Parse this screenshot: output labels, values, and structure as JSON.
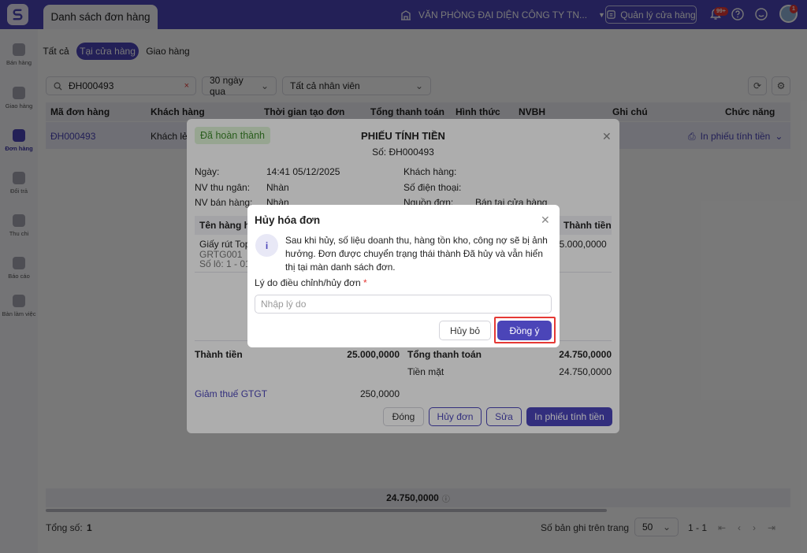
{
  "app": {
    "tab_title": "Danh sách đơn hàng",
    "branch_name": "VĂN PHÒNG ĐẠI DIỆN CÔNG TY TN...",
    "store_mgmt_label": "Quản lý cửa hàng",
    "notification_badge": "99+",
    "avatar_badge": "1",
    "accent_color": "#4b45b8"
  },
  "sidebar": {
    "items": [
      {
        "label": "Bán hàng",
        "icon": "cart-icon"
      },
      {
        "label": "Giao hàng",
        "icon": "truck-icon"
      },
      {
        "label": "Đơn hàng",
        "icon": "document-icon"
      },
      {
        "label": "Đổi trả",
        "icon": "return-icon"
      },
      {
        "label": "Thu chi",
        "icon": "wallet-icon"
      },
      {
        "label": "Báo cáo",
        "icon": "report-icon"
      },
      {
        "label": "Bàn làm việc",
        "icon": "grid-icon"
      }
    ],
    "active": "Đơn hàng"
  },
  "filters": {
    "tabs": [
      "Tất cả",
      "Tại cửa hàng",
      "Giao hàng"
    ],
    "active_tab": "Tại cửa hàng",
    "search_value": "ĐH000493",
    "date_range": "30 ngày qua",
    "staff": "Tất cả nhân viên"
  },
  "table": {
    "columns": [
      "Mã đơn hàng",
      "Khách hàng",
      "Thời gian tạo đơn",
      "Tổng thanh toán",
      "Hình thức",
      "NVBH",
      "Ghi chú",
      "Chức năng"
    ],
    "rows": [
      {
        "code": "ĐH000493",
        "customer": "Khách lẻ",
        "action": "In phiếu tính tiền"
      }
    ],
    "total": "24.750,0000"
  },
  "footer": {
    "total_label": "Tổng số:",
    "total_count": "1",
    "page_size_label": "Số bản ghi trên trang",
    "page_size": "50",
    "range": "1 - 1"
  },
  "invoice": {
    "status": "Đã hoàn thành",
    "title": "PHIẾU TÍNH TIỀN",
    "number": "Số: ĐH000493",
    "date_label": "Ngày:",
    "date_value": "14:41 05/12/2025",
    "cashier_label": "NV thu ngân:",
    "cashier_value": "Nhàn",
    "seller_label": "NV bán hàng:",
    "seller_value": "Nhàn",
    "customer_label": "Khách hàng:",
    "phone_label": "Số điện thoại:",
    "source_label": "Nguồn đơn:",
    "source_value": "Bán tại cửa hàng",
    "col_product": "Tên hàng hó",
    "col_amount": "Thành tiền",
    "item_name": "Giấy rút Top",
    "item_code": "GRTG001",
    "item_lot": "Số lô: 1 - 01/",
    "item_amount": "25.000,0000",
    "subtotal_label": "Thành tiền",
    "subtotal_value": "25.000,0000",
    "grand_total_label": "Tổng thanh toán",
    "grand_total_value": "24.750,0000",
    "cash_label": "Tiền mặt",
    "cash_value": "24.750,0000",
    "vat_label": "Giảm thuế GTGT",
    "vat_value": "250,0000",
    "btn_close": "Đóng",
    "btn_cancel": "Hủy đơn",
    "btn_edit": "Sửa",
    "btn_print": "In phiếu tính tiền"
  },
  "dialog": {
    "title": "Hủy hóa đơn",
    "message": "Sau khi hủy, số liệu doanh thu, hàng tồn kho, công nợ sẽ bị ảnh hưởng. Đơn được chuyển trạng thái thành Đã hủy và vẫn hiển thị tại màn danh sách đơn.",
    "reason_label": "Lý do điều chỉnh/hủy đơn",
    "required_mark": "*",
    "reason_placeholder": "Nhập lý do",
    "btn_cancel": "Hủy bỏ",
    "btn_confirm": "Đồng ý"
  }
}
